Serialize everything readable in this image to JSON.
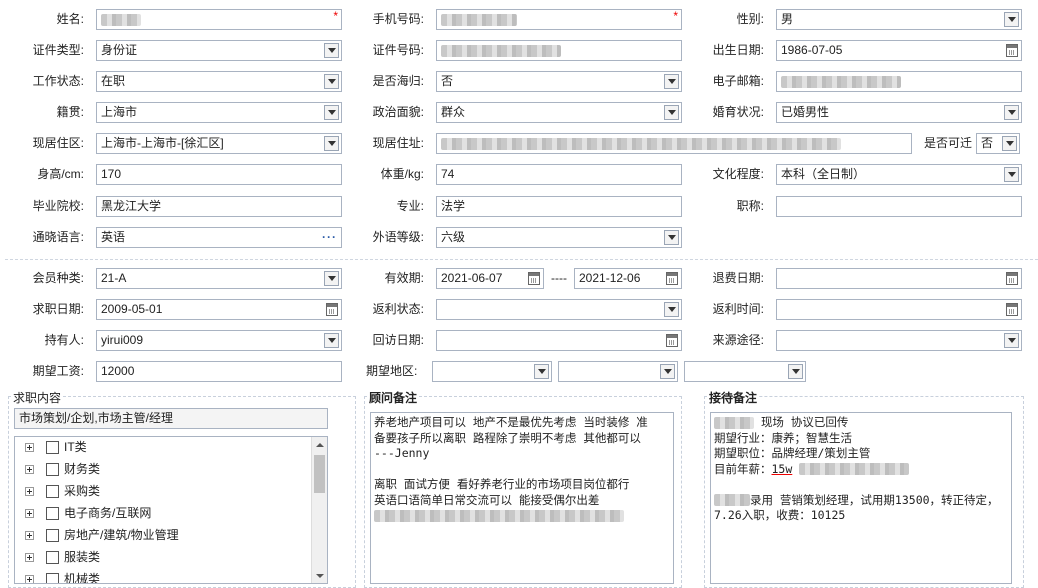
{
  "personal": {
    "name": {
      "label": "姓名:",
      "required_mark": "*"
    },
    "phone": {
      "label": "手机号码:",
      "required_mark": "*"
    },
    "gender": {
      "label": "性别:",
      "value": "男"
    },
    "id_type": {
      "label": "证件类型:",
      "value": "身份证"
    },
    "id_number": {
      "label": "证件号码:"
    },
    "birth_date": {
      "label": "出生日期:",
      "value": "1986-07-05"
    },
    "work_status": {
      "label": "工作状态:",
      "value": "在职"
    },
    "overseas": {
      "label": "是否海归:",
      "value": "否"
    },
    "email": {
      "label": "电子邮箱:"
    },
    "native_place": {
      "label": "籍贯:",
      "value": "上海市"
    },
    "political": {
      "label": "政治面貌:",
      "value": "群众"
    },
    "marital": {
      "label": "婚育状况:",
      "value": "已婚男性"
    },
    "residence_area": {
      "label": "现居住区:",
      "value": "上海市-上海市-[徐汇区]"
    },
    "residence_addr": {
      "label": "现居住址:"
    },
    "relocate": {
      "label": "是否可迁",
      "value": "否"
    },
    "height": {
      "label": "身高/cm:",
      "value": "170"
    },
    "weight": {
      "label": "体重/kg:",
      "value": "74"
    },
    "education": {
      "label": "文化程度:",
      "value": "本科（全日制）"
    },
    "school": {
      "label": "毕业院校:",
      "value": "黑龙江大学"
    },
    "major": {
      "label": "专业:",
      "value": "法学"
    },
    "title": {
      "label": "职称:",
      "value": ""
    },
    "language": {
      "label": "通晓语言:",
      "value": "英语",
      "more": "···"
    },
    "lang_level": {
      "label": "外语等级:",
      "value": "六级"
    }
  },
  "membership": {
    "member_type": {
      "label": "会员种类:",
      "value": "21-A"
    },
    "valid": {
      "label": "有效期:",
      "from": "2021-06-07",
      "sep": "----",
      "to": "2021-12-06"
    },
    "refund_date": {
      "label": "退费日期:",
      "value": ""
    },
    "job_date": {
      "label": "求职日期:",
      "value": "2009-05-01"
    },
    "rebate_status": {
      "label": "返利状态:",
      "value": ""
    },
    "rebate_time": {
      "label": "返利时间:",
      "value": ""
    },
    "holder": {
      "label": "持有人:",
      "value": "yirui009"
    },
    "visit_date": {
      "label": "回访日期:",
      "value": ""
    },
    "source": {
      "label": "来源途径:",
      "value": ""
    },
    "salary": {
      "label": "期望工资:",
      "value": "12000"
    },
    "region": {
      "label": "期望地区:"
    }
  },
  "job_content": {
    "title": "求职内容",
    "selected": "市场策划/企划,市场主管/经理",
    "categories": [
      "IT类",
      "财务类",
      "采购类",
      "电子商务/互联网",
      "房地产/建筑/物业管理",
      "服装类",
      "机械类"
    ]
  },
  "consultant_notes": {
    "title": "顾问备注",
    "lines": [
      "养老地产项目可以  地产不是最优先考虑  当时装修 准",
      "备要孩子所以离职  路程除了崇明不考虑 其他都可以",
      "---Jenny",
      "",
      "离职 面试方便 看好养老行业的市场项目岗位都行",
      "英语口语简单日常交流可以  能接受偶尔出差"
    ]
  },
  "reception_notes": {
    "title": "接待备注",
    "line1": "现场 协议已回传",
    "line2": "期望行业：康养；智慧生活",
    "line3": "期望职位：品牌经理/策划主管",
    "line4_label": "目前年薪：",
    "line4_value": "15w",
    "line5": "录用 营销策划经理，试用期13500，转正待定，",
    "line6": "7.26入职，收费：10125"
  }
}
